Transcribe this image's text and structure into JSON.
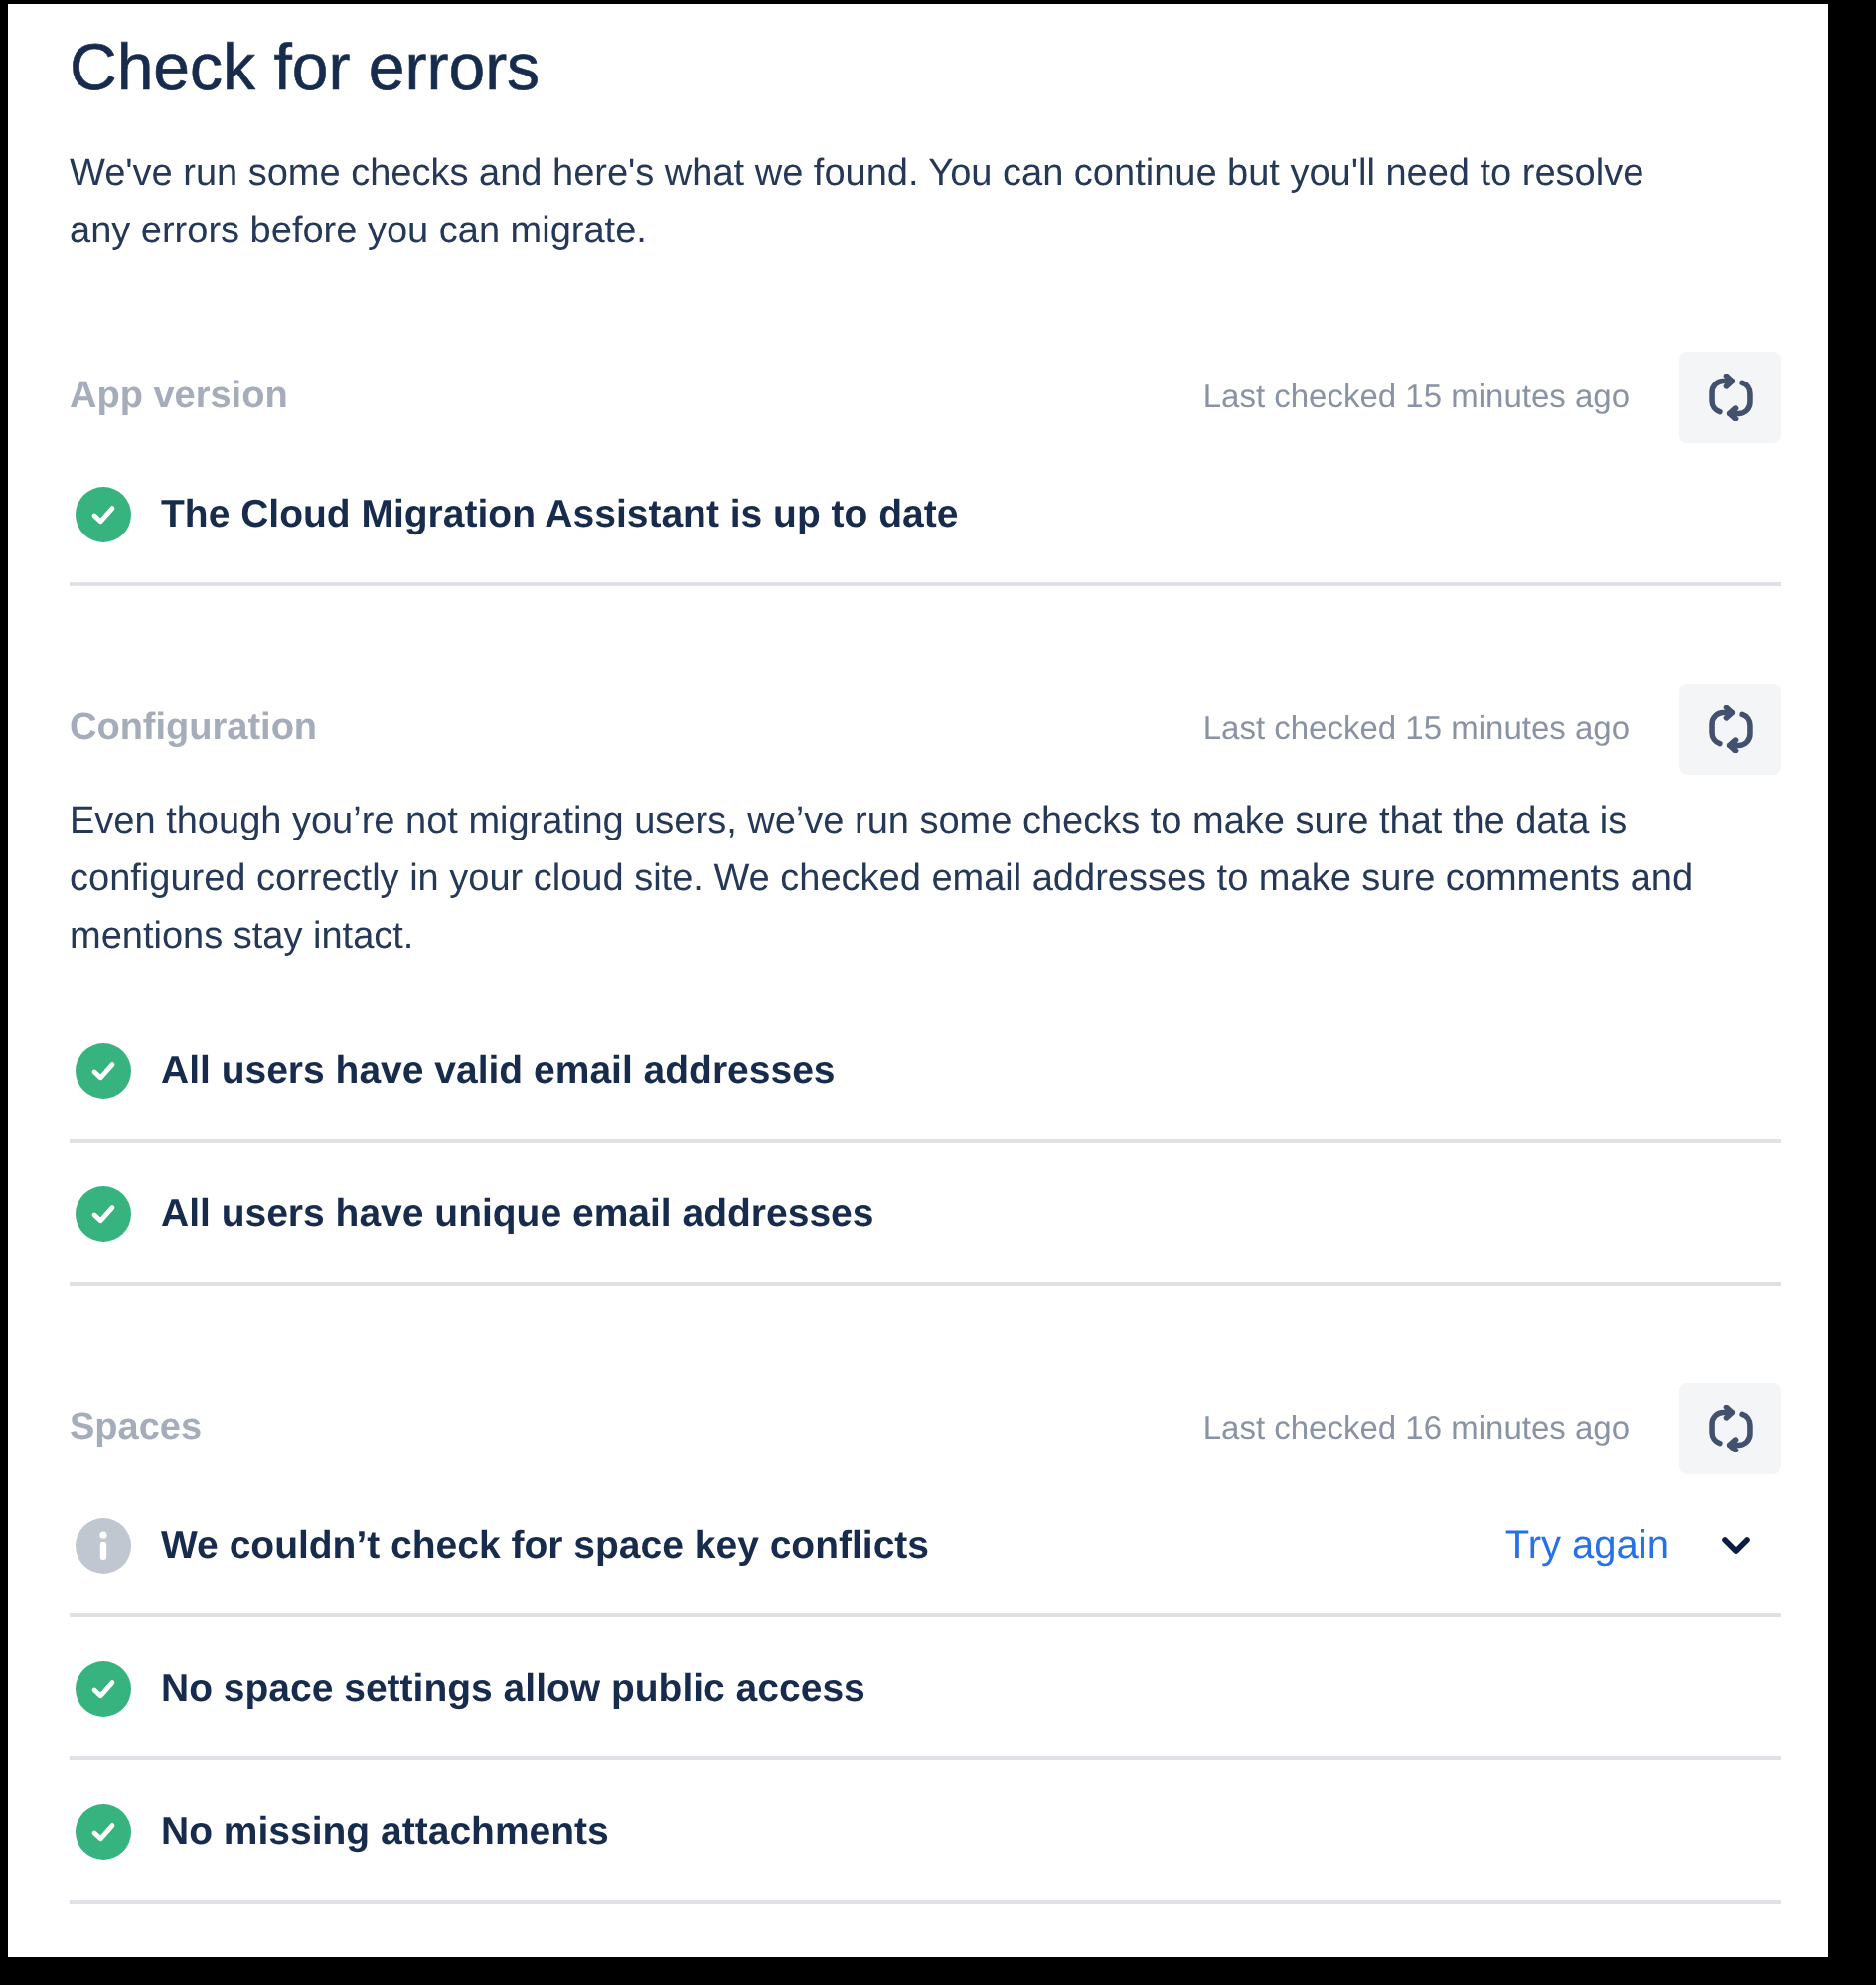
{
  "page": {
    "title": "Check for errors",
    "intro": "We've run some checks and here's what we found. You can continue but you'll need to resolve any errors before you can migrate."
  },
  "sections": [
    {
      "title": "App version",
      "last_checked": "Last checked 15 minutes ago",
      "checks": [
        {
          "kind": "passed",
          "text": "The Cloud Migration Assistant is up to date"
        }
      ]
    },
    {
      "title": "Configuration",
      "last_checked": "Last checked 15 minutes ago",
      "description": "Even though you’re not migrating users, we’ve run some checks to make sure that the data is configured correctly in your cloud site. We checked email addresses to make sure comments and mentions stay intact.",
      "checks": [
        {
          "kind": "passed",
          "text": "All users have valid email addresses"
        },
        {
          "kind": "passed",
          "text": "All users have unique email addresses"
        }
      ]
    },
    {
      "title": "Spaces",
      "last_checked": "Last checked 16 minutes ago",
      "checks": [
        {
          "kind": "unknown",
          "text": "We couldn’t check for space key conflicts",
          "action": "Try again",
          "expanded": false
        },
        {
          "kind": "passed",
          "text": "No space settings allow public access"
        },
        {
          "kind": "passed",
          "text": "No missing attachments"
        }
      ]
    }
  ]
}
